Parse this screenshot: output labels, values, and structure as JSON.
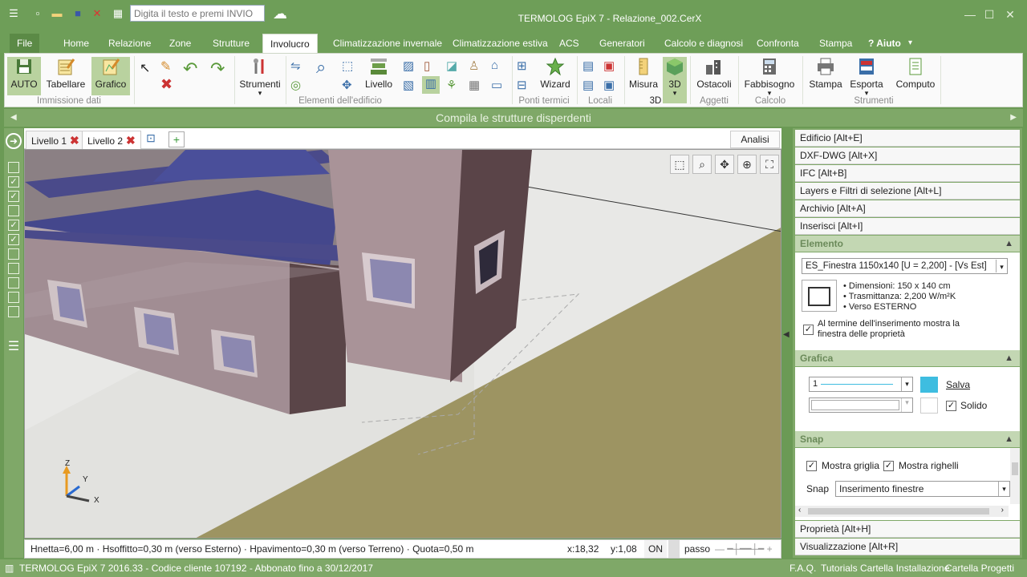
{
  "search": {
    "placeholder": "Digita il testo e premi INVIO"
  },
  "window": {
    "title": "TERMOLOG EpiX 7 - Relazione_002.CerX"
  },
  "tabs": [
    "File",
    "Home",
    "Relazione",
    "Zone",
    "Strutture",
    "Involucro",
    "Climatizzazione invernale",
    "Climatizzazione estiva",
    "ACS",
    "Generatori",
    "Calcolo e diagnosi",
    "Confronta",
    "Stampa",
    "? Aiuto"
  ],
  "active_tab": "Involucro",
  "ribbon": {
    "auto": "AUTO",
    "tabellare": "Tabellare",
    "grafico": "Grafico",
    "strumenti": "Strumenti",
    "livello": "Livello",
    "wizard": "Wizard",
    "misura": "Misura",
    "3d": "3D",
    "ostacoli": "Ostacoli",
    "fabbisogno": "Fabbisogno",
    "stampa": "Stampa",
    "esporta": "Esporta",
    "computo": "Computo",
    "groups": {
      "immissione": "Immissione dati",
      "elementi": "Elementi dell'edificio",
      "ponti": "Ponti termici",
      "locali": "Locali",
      "g3d": "3D",
      "aggetti": "Aggetti",
      "calcolo": "Calcolo",
      "strumenti": "Strumenti"
    }
  },
  "banner": "Compila le strutture disperdenti",
  "viewport_tabs": [
    {
      "label": "Livello 1"
    },
    {
      "label": "Livello 2"
    }
  ],
  "analisi": "Analisi",
  "axes": {
    "z": "Z",
    "y": "Y",
    "x": "X"
  },
  "coord": {
    "info": "Hnetta=6,00 m · Hsoffitto=0,30 m (verso Esterno) · Hpavimento=0,30 m (verso Terreno) · Quota=0,50 m",
    "x": "x:18,32",
    "y": "y:1,08",
    "on": "ON",
    "passo": "passo"
  },
  "panel": {
    "top_items": [
      "Edificio [Alt+E]",
      "DXF-DWG [Alt+X]",
      "IFC [Alt+B]",
      "Layers e Filtri di selezione [Alt+L]",
      "Archivio [Alt+A]",
      "Inserisci [Alt+I]"
    ],
    "elemento": {
      "title": "Elemento",
      "select": "ES_Finestra 1150x140 [U = 2,200] - [Vs Est]",
      "details": [
        "Dimensioni: 150 x 140 cm",
        "Trasmittanza: 2,200 W/m²K",
        "Verso ESTERNO"
      ],
      "check": "Al termine dell'inserimento mostra la finestra delle proprietà"
    },
    "grafica": {
      "title": "Grafica",
      "line_value": "1",
      "salva": "Salva",
      "solido": "Solido",
      "color": "#3ebde0"
    },
    "snap": {
      "title": "Snap",
      "griglia": "Mostra griglia",
      "righelli": "Mostra righelli",
      "snap_label": "Snap",
      "snap_value": "Inserimento finestre"
    },
    "bottom_items": [
      "Proprietà [Alt+H]",
      "Visualizzazione [Alt+R]"
    ]
  },
  "status": {
    "left": "TERMOLOG EpiX 7 2016.33 - Codice cliente 107192 - Abbonato fino a 30/12/2017",
    "links": [
      "F.A.Q.",
      "Tutorials",
      "Cartella Installazione",
      "Cartella Progetti"
    ]
  }
}
